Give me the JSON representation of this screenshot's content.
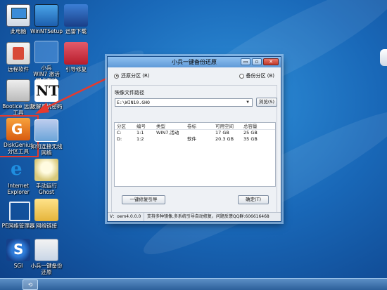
{
  "desktop": {
    "icons": [
      {
        "label": "此电脑",
        "icon": "computer-icon"
      },
      {
        "label": "WinNTSetup",
        "icon": "setup-icon"
      },
      {
        "label": "迅雷下载",
        "icon": "thunder-icon"
      },
      {
        "label": "远程软件",
        "icon": "remote-software-icon"
      },
      {
        "label": "小兵\nWIN7 激活\n网卡驱动",
        "icon": "onekey-icon"
      },
      {
        "label": "引导修复",
        "icon": "boot-repair-icon"
      },
      {
        "label": "Bootice 远启\n工具",
        "icon": "bootice-icon"
      },
      {
        "label": "破解系统密码",
        "icon": "nt-password-icon"
      },
      {
        "label": "DiskGenius\n分区工具",
        "icon": "diskgenius-icon"
      },
      {
        "label": "如何连接无线\n网络",
        "icon": "wifi-guide-icon"
      },
      {
        "label": "Internet\nExplorer",
        "icon": "ie-icon"
      },
      {
        "label": "手动运行\nGhost",
        "icon": "ghost-icon"
      },
      {
        "label": "PE网络管理器",
        "icon": "network-manager-icon"
      },
      {
        "label": "网络链接",
        "icon": "network-link-icon"
      },
      {
        "label": "SGI",
        "icon": "sgi-icon"
      },
      {
        "label": "小兵一键备份\n还原",
        "icon": "backup-restore-icon"
      }
    ]
  },
  "dialog": {
    "title": "小兵一键备份还原",
    "minimize": "▭",
    "maximize": "▫",
    "close": "✕",
    "radio_restore": "还原分区 (R)",
    "radio_backup": "备份分区 (B)",
    "image_path_label": "映像文件路径",
    "image_path_value": "E:\\WIN10.GHO",
    "browse_button": "浏览(S)",
    "table": {
      "headers": [
        "分区",
        "编号",
        "类型",
        "卷标",
        "可用空间",
        "总容量"
      ],
      "rows": [
        [
          "C:",
          "1:1",
          "WIN7,活动",
          "",
          "17 GB",
          "25 GB"
        ],
        [
          "D:",
          "1:2",
          "",
          "软件",
          "20.3 GB",
          "35 GB"
        ]
      ]
    },
    "repair_button": "一键修复引导",
    "ok_button": "确定(T)",
    "version": "V：oem4.0.0.0",
    "status": "支持多种镜像,多系统引导自动修复，问题反馈QQ群:606616468"
  },
  "colors": {
    "highlight": "#e53a2e",
    "arrow": "#e53a2e",
    "titlebar": "#7fb2e6"
  }
}
